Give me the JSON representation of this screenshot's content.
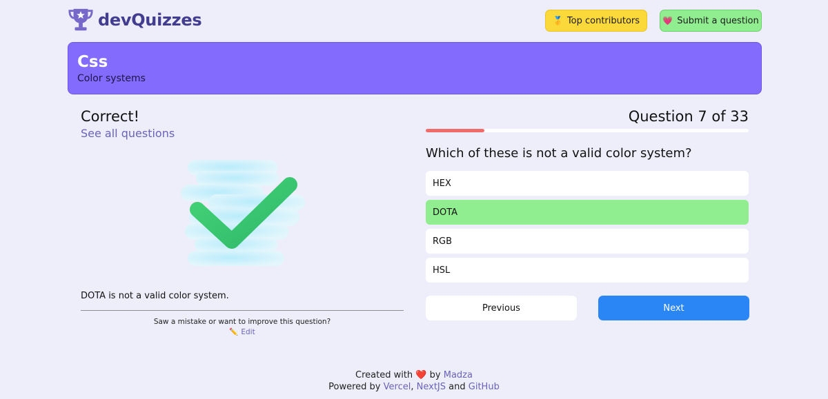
{
  "header": {
    "logo_text": "devQuizzes",
    "top_contributors_label": "Top contributors",
    "submit_question_label": "Submit a question",
    "colors": {
      "top_contributors_bg": "#fcd93b",
      "submit_bg": "#90ee90"
    }
  },
  "banner": {
    "title": "Css",
    "subtitle": "Color systems",
    "color": "#836cfd"
  },
  "result": {
    "title": "Correct!",
    "see_all_label": "See all questions",
    "explanation": "DOTA is not a valid color system.",
    "mistake_text": "Saw a mistake or want to improve this question?",
    "edit_label": "Edit"
  },
  "quiz": {
    "progress_text": "Question 7 of 33",
    "progress_fraction": 0.1818,
    "question": "Which of these is not a valid color system?",
    "options": [
      {
        "label": "HEX",
        "state": "default"
      },
      {
        "label": "DOTA",
        "state": "correct"
      },
      {
        "label": "RGB",
        "state": "default"
      },
      {
        "label": "HSL",
        "state": "default"
      }
    ],
    "previous_label": "Previous",
    "next_label": "Next",
    "colors": {
      "correct": "#90ee90",
      "next_button": "#2a86f5",
      "progress": "#f26b6b"
    }
  },
  "footer": {
    "created_with": "Created with",
    "by": "by",
    "author": "Madza",
    "powered_by": "Powered by",
    "vercel": "Vercel",
    "comma": ",",
    "nextjs": "NextJS",
    "and": "and",
    "github": "GitHub"
  },
  "icons": {
    "logo": "trophy-icon",
    "top_contributors": "medal-icon",
    "submit": "heart-icon",
    "edit": "pencil-icon",
    "result": "checkmark-icon"
  }
}
